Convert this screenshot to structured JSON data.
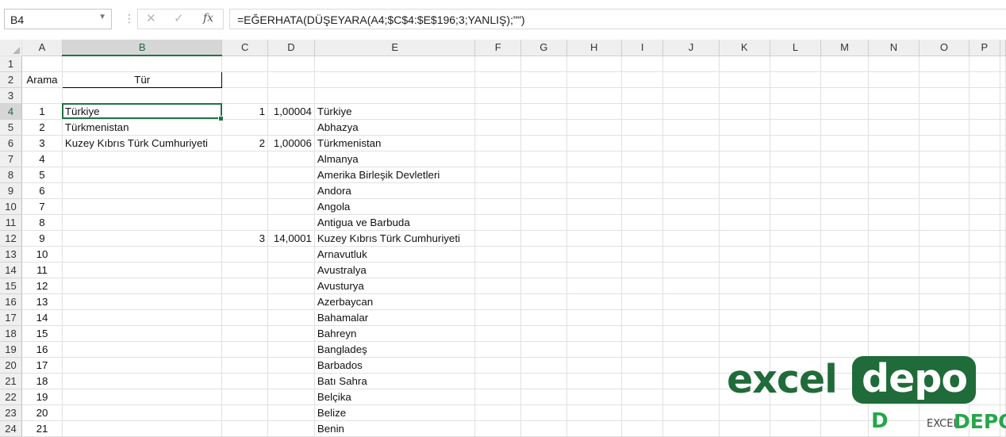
{
  "name_box": {
    "value": "B4",
    "dropdown_icon": "chevron-down-icon"
  },
  "formula_bar": {
    "cancel_icon": "cross-icon",
    "enter_icon": "check-icon",
    "insert_function_label": "fx",
    "formula": "=EĞERHATA(DÜŞEYARA(A4;$C$4:$E$196;3;YANLIŞ);\"\")"
  },
  "columns": [
    "A",
    "B",
    "C",
    "D",
    "E",
    "F",
    "G",
    "H",
    "I",
    "J",
    "K",
    "L",
    "M",
    "N",
    "O",
    "P"
  ],
  "selected_cell": {
    "column": "B",
    "row": 4
  },
  "rows": [
    {
      "n": "1",
      "A": "",
      "B": "",
      "C": "",
      "D": "",
      "E": ""
    },
    {
      "n": "2",
      "A": "Arama",
      "B": "Tür",
      "C": "",
      "D": "",
      "E": ""
    },
    {
      "n": "3",
      "A": "",
      "B": "",
      "C": "",
      "D": "",
      "E": ""
    },
    {
      "n": "4",
      "A": "1",
      "B": "Türkiye",
      "C": "1",
      "D": "1,00004",
      "E": "Türkiye"
    },
    {
      "n": "5",
      "A": "2",
      "B": "Türkmenistan",
      "C": "",
      "D": "",
      "E": "Abhazya"
    },
    {
      "n": "6",
      "A": "3",
      "B": "Kuzey Kıbrıs Türk Cumhuriyeti",
      "C": "2",
      "D": "1,00006",
      "E": "Türkmenistan"
    },
    {
      "n": "7",
      "A": "4",
      "B": "",
      "C": "",
      "D": "",
      "E": "Almanya"
    },
    {
      "n": "8",
      "A": "5",
      "B": "",
      "C": "",
      "D": "",
      "E": "Amerika Birleşik Devletleri"
    },
    {
      "n": "9",
      "A": "6",
      "B": "",
      "C": "",
      "D": "",
      "E": "Andora"
    },
    {
      "n": "10",
      "A": "7",
      "B": "",
      "C": "",
      "D": "",
      "E": "Angola"
    },
    {
      "n": "11",
      "A": "8",
      "B": "",
      "C": "",
      "D": "",
      "E": "Antigua ve Barbuda"
    },
    {
      "n": "12",
      "A": "9",
      "B": "",
      "C": "3",
      "D": "14,0001",
      "E": "Kuzey Kıbrıs Türk Cumhuriyeti"
    },
    {
      "n": "13",
      "A": "10",
      "B": "",
      "C": "",
      "D": "",
      "E": "Arnavutluk"
    },
    {
      "n": "14",
      "A": "11",
      "B": "",
      "C": "",
      "D": "",
      "E": "Avustralya"
    },
    {
      "n": "15",
      "A": "12",
      "B": "",
      "C": "",
      "D": "",
      "E": "Avusturya"
    },
    {
      "n": "16",
      "A": "13",
      "B": "",
      "C": "",
      "D": "",
      "E": "Azerbaycan"
    },
    {
      "n": "17",
      "A": "14",
      "B": "",
      "C": "",
      "D": "",
      "E": "Bahamalar"
    },
    {
      "n": "18",
      "A": "15",
      "B": "",
      "C": "",
      "D": "",
      "E": "Bahreyn"
    },
    {
      "n": "19",
      "A": "16",
      "B": "",
      "C": "",
      "D": "",
      "E": "Bangladeş"
    },
    {
      "n": "20",
      "A": "17",
      "B": "",
      "C": "",
      "D": "",
      "E": "Barbados"
    },
    {
      "n": "21",
      "A": "18",
      "B": "",
      "C": "",
      "D": "",
      "E": "Batı Sahra"
    },
    {
      "n": "22",
      "A": "19",
      "B": "",
      "C": "",
      "D": "",
      "E": "Belçika"
    },
    {
      "n": "23",
      "A": "20",
      "B": "",
      "C": "",
      "D": "",
      "E": "Belize"
    },
    {
      "n": "24",
      "A": "21",
      "B": "",
      "C": "",
      "D": "",
      "E": "Benin"
    }
  ],
  "watermark": {
    "excel": "excel",
    "depo": "depo",
    "small_left": "D",
    "small_mid": "EXCEL",
    "small_right": "DEPO"
  },
  "colors": {
    "accent": "#217346",
    "logo_green": "#1f6b39"
  }
}
